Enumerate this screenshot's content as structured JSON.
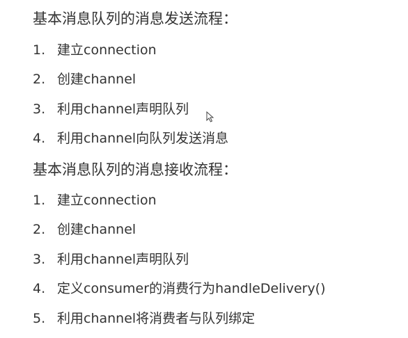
{
  "sections": [
    {
      "title": "基本消息队列的消息发送流程：",
      "steps": [
        {
          "num": "1.",
          "text": "建立connection"
        },
        {
          "num": "2.",
          "text": "创建channel"
        },
        {
          "num": "3.",
          "text": "利用channel声明队列"
        },
        {
          "num": "4.",
          "text": "利用channel向队列发送消息"
        }
      ]
    },
    {
      "title": "基本消息队列的消息接收流程：",
      "steps": [
        {
          "num": "1.",
          "text": "建立connection"
        },
        {
          "num": "2.",
          "text": "创建channel"
        },
        {
          "num": "3.",
          "text": "利用channel声明队列"
        },
        {
          "num": "4.",
          "text": "定义consumer的消费行为handleDelivery()"
        },
        {
          "num": "5.",
          "text": "利用channel将消费者与队列绑定"
        }
      ]
    }
  ],
  "cursor_icon": "mouse-pointer-icon"
}
